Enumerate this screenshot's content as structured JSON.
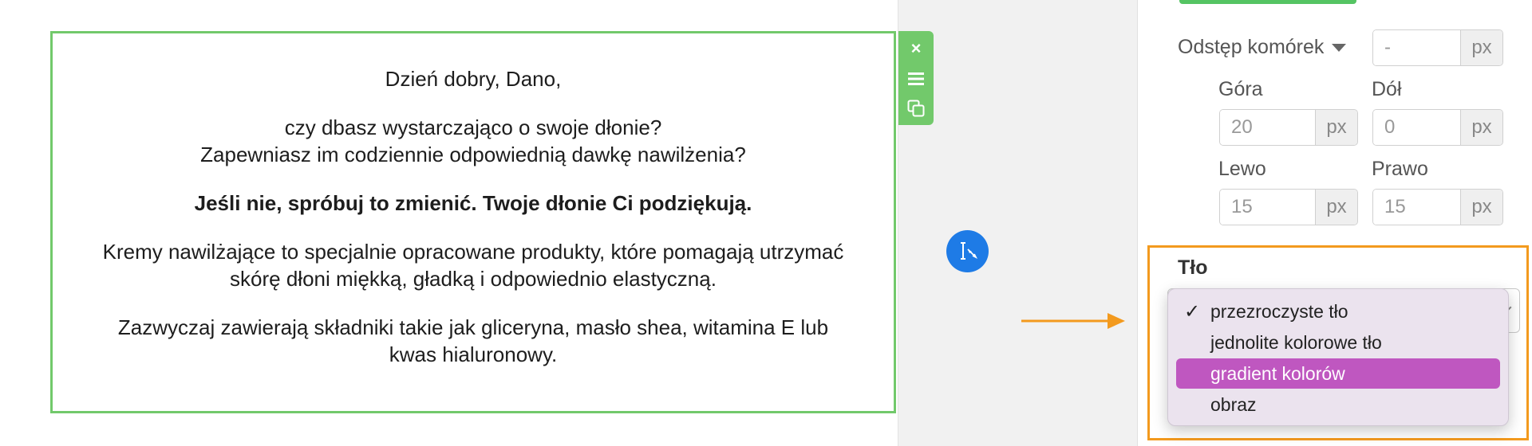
{
  "email_block": {
    "greeting": "Dzień dobry, Dano,",
    "question_line1": "czy dbasz wystarczająco o swoje dłonie?",
    "question_line2": "Zapewniasz im codziennie odpowiednią dawkę nawilżenia?",
    "bold_line": "Jeśli nie, spróbuj to zmienić. Twoje dłonie Ci podziękują.",
    "para1_line1": "Kremy nawilżające to specjalnie opracowane produkty, które pomagają utrzymać",
    "para1_line2": "skórę dłoni miękką, gładką i odpowiednio elastyczną.",
    "para2_line1": "Zazwyczaj zawierają składniki takie jak gliceryna, masło shea, witamina E lub",
    "para2_line2": "kwas hialuronowy."
  },
  "block_toolbar": {
    "close_symbol": "×",
    "icons": [
      "close-icon",
      "menu-icon",
      "copy-icon"
    ]
  },
  "panel": {
    "cell_spacing": {
      "label": "Odstęp komórek",
      "placeholder": "-",
      "unit": "px"
    },
    "padding": {
      "top_label": "Góra",
      "top_value": "20",
      "bottom_label": "Dół",
      "bottom_value": "0",
      "left_label": "Lewo",
      "left_value": "15",
      "right_label": "Prawo",
      "right_value": "15",
      "unit": "px"
    },
    "background": {
      "label": "Tło",
      "options": [
        {
          "label": "przezroczyste tło",
          "checked": true
        },
        {
          "label": "jednolite kolorowe tło",
          "checked": false
        },
        {
          "label": "gradient kolorów",
          "checked": false,
          "highlighted": true
        },
        {
          "label": "obraz",
          "checked": false
        }
      ],
      "check_symbol": "✓"
    }
  },
  "colors": {
    "block_border": "#72c96b",
    "fab": "#1e7be6",
    "highlight_frame": "#f39a1e",
    "option_highlight": "#bf57c0"
  }
}
